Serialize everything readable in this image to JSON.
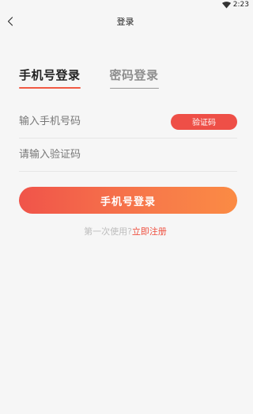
{
  "status_bar": {
    "time": "2:23",
    "wifi_icon": "wifi-icon"
  },
  "header": {
    "title": "登录",
    "back_icon": "chevron-left-icon"
  },
  "tabs": [
    {
      "label": "手机号登录",
      "active": true
    },
    {
      "label": "密码登录",
      "active": false
    }
  ],
  "form": {
    "phone_placeholder": "输入手机号码",
    "code_placeholder": "请输入验证码",
    "code_button_label": "验证码"
  },
  "login_button_label": "手机号登录",
  "register": {
    "prompt": "第一次使用?",
    "link": "立即注册"
  },
  "colors": {
    "accent": "#f15a44",
    "button_gradient_start": "#f0544a",
    "button_gradient_end": "#fb8b44",
    "background": "#f6f6f6"
  }
}
